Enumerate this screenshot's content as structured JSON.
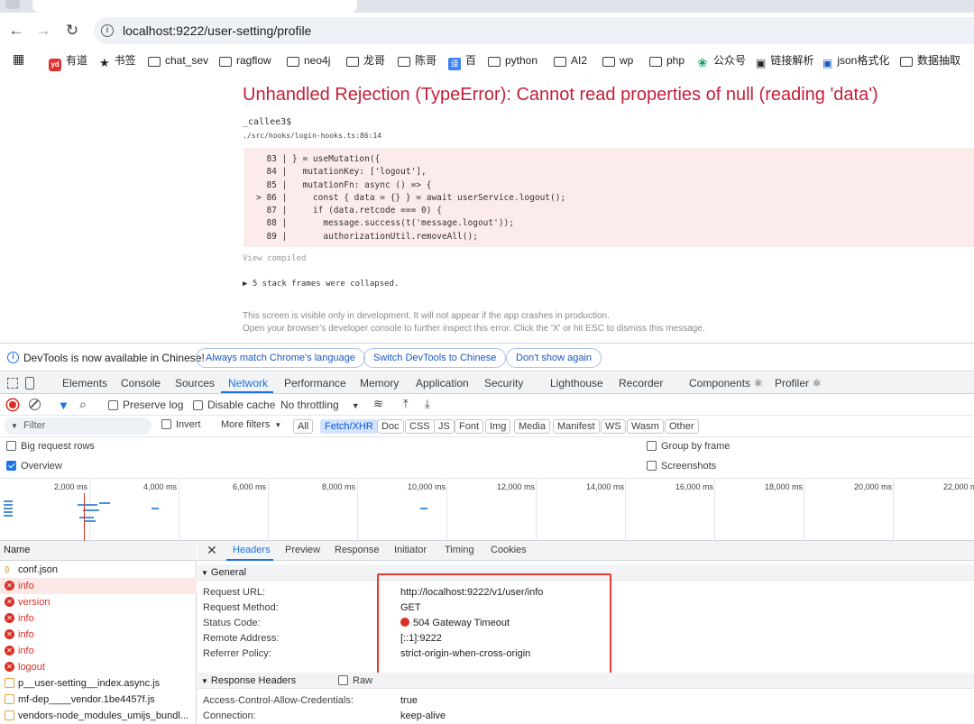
{
  "browser": {
    "url": "localhost:9222/user-setting/profile",
    "bookmarks": [
      {
        "label": "有道",
        "icon": "youdao-icon"
      },
      {
        "label": "书签",
        "icon": "star-icon"
      },
      {
        "label": "chat_sev",
        "icon": "folder-icon"
      },
      {
        "label": "ragflow",
        "icon": "folder-icon"
      },
      {
        "label": "neo4j",
        "icon": "folder-icon"
      },
      {
        "label": "龙哥",
        "icon": "folder-icon"
      },
      {
        "label": "陈哥",
        "icon": "folder-icon"
      },
      {
        "label": "百",
        "icon": "translate-icon"
      },
      {
        "label": "python",
        "icon": "folder-icon"
      },
      {
        "label": "AI2",
        "icon": "folder-icon"
      },
      {
        "label": "wp",
        "icon": "folder-icon"
      },
      {
        "label": "php",
        "icon": "folder-icon"
      },
      {
        "label": "公众号",
        "icon": "wechat-icon"
      },
      {
        "label": "链接解析",
        "icon": "bookmark-icon"
      },
      {
        "label": "json格式化",
        "icon": "bookmark-icon"
      },
      {
        "label": "数据抽取",
        "icon": "folder-icon"
      }
    ]
  },
  "error": {
    "title": "Unhandled Rejection (TypeError): Cannot read properties of null (reading 'data')",
    "function": "_callee3$",
    "file": "./src/hooks/login-hooks.ts:86:14",
    "code_lines": [
      "  83 | } = useMutation({",
      "  84 |   mutationKey: ['logout'],",
      "  85 |   mutationFn: async () => {",
      "> 86 |     const { data = {} } = await userService.logout();",
      "  87 |     if (data.retcode === 0) {",
      "  88 |       message.success(t('message.logout'));",
      "  89 |       authorizationUtil.removeAll();"
    ],
    "view_compiled": "View compiled",
    "collapsed": "▶ 5 stack frames were collapsed.",
    "note1": "This screen is visible only in development. It will not appear if the app crashes in production.",
    "note2": "Open your browser’s developer console to further inspect this error.  Click the 'X' or hit ESC to dismiss this message."
  },
  "infobar": {
    "message": "DevTools is now available in Chinese!",
    "btn_match": "Always match Chrome's language",
    "btn_switch": "Switch DevTools to Chinese",
    "btn_dont": "Don't show again"
  },
  "devtools_tabs": [
    "Elements",
    "Console",
    "Sources",
    "Network",
    "Performance",
    "Memory",
    "Application",
    "Security",
    "Lighthouse",
    "Recorder",
    "Components ⚛",
    "Profiler ⚛"
  ],
  "network_toolbar": {
    "preserve_log": "Preserve log",
    "disable_cache": "Disable cache",
    "throttling": "No throttling"
  },
  "filter_bar": {
    "placeholder": "Filter",
    "invert": "Invert",
    "more_filters": "More filters",
    "types": [
      "All",
      "Fetch/XHR",
      "Doc",
      "CSS",
      "JS",
      "Font",
      "Img",
      "Media",
      "Manifest",
      "WS",
      "Wasm",
      "Other"
    ],
    "active_type": "Fetch/XHR"
  },
  "options": {
    "big_rows": "Big request rows",
    "group_by_frame": "Group by frame",
    "overview": "Overview",
    "screenshots": "Screenshots"
  },
  "timeline_ticks": [
    "2,000 ms",
    "4,000 ms",
    "6,000 ms",
    "8,000 ms",
    "10,000 ms",
    "12,000 ms",
    "14,000 ms",
    "16,000 ms",
    "18,000 ms",
    "20,000 ms",
    "22,000 m"
  ],
  "requests": {
    "header": "Name",
    "rows": [
      {
        "name": "conf.json",
        "type": "json",
        "error": false,
        "selected": false
      },
      {
        "name": "info",
        "type": "error",
        "error": true,
        "selected": true
      },
      {
        "name": "version",
        "type": "error",
        "error": true,
        "selected": false
      },
      {
        "name": "info",
        "type": "error",
        "error": true,
        "selected": false
      },
      {
        "name": "info",
        "type": "error",
        "error": true,
        "selected": false
      },
      {
        "name": "info",
        "type": "error",
        "error": true,
        "selected": false
      },
      {
        "name": "logout",
        "type": "error",
        "error": true,
        "selected": false
      },
      {
        "name": "p__user-setting__index.async.js",
        "type": "js",
        "error": false,
        "selected": false
      },
      {
        "name": "mf-dep____vendor.1be4457f.js",
        "type": "js",
        "error": false,
        "selected": false
      },
      {
        "name": "vendors-node_modules_umijs_bundl...",
        "type": "js",
        "error": false,
        "selected": false
      }
    ]
  },
  "detail": {
    "tabs": [
      "Headers",
      "Preview",
      "Response",
      "Initiator",
      "Timing",
      "Cookies"
    ],
    "general_title": "General",
    "general": [
      {
        "key": "Request URL:",
        "value": "http://localhost:9222/v1/user/info"
      },
      {
        "key": "Request Method:",
        "value": "GET"
      },
      {
        "key": "Status Code:",
        "value": "504 Gateway Timeout"
      },
      {
        "key": "Remote Address:",
        "value": "[::1]:9222"
      },
      {
        "key": "Referrer Policy:",
        "value": "strict-origin-when-cross-origin"
      }
    ],
    "response_headers_title": "Response Headers",
    "raw_label": "Raw",
    "response_headers": [
      {
        "key": "Access-Control-Allow-Credentials:",
        "value": "true"
      },
      {
        "key": "Connection:",
        "value": "keep-alive"
      }
    ]
  },
  "colors": {
    "error_red": "#c41e3a",
    "accent_blue": "#1a73e8",
    "highlight_box": "#e53935"
  }
}
